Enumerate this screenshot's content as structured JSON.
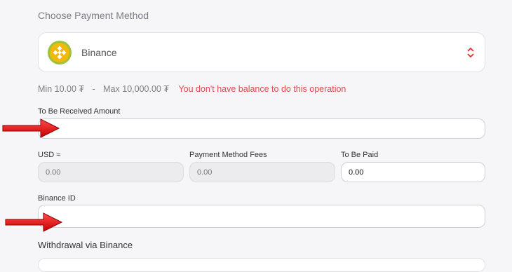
{
  "header": {
    "title": "Choose Payment Method"
  },
  "payment_select": {
    "selected": "Binance",
    "icon": "binance-icon"
  },
  "limits": {
    "min": "Min 10.00 ₮",
    "separator": "-",
    "max": "Max 10,000.00 ₮",
    "error": "You don't have balance to do this operation"
  },
  "received": {
    "label": "To Be Received Amount",
    "value": ""
  },
  "usd": {
    "label": "USD ≈",
    "placeholder": "0.00"
  },
  "fees": {
    "label": "Payment Method Fees",
    "placeholder": "0.00"
  },
  "paid": {
    "label": "To Be Paid",
    "value": "0.00"
  },
  "binance_id": {
    "label": "Binance ID",
    "value": ""
  },
  "withdrawal": {
    "title": "Withdrawal via Binance"
  },
  "colors": {
    "error": "#e04b4b",
    "arrow": "#e01818",
    "binance": "#f0b90b"
  }
}
